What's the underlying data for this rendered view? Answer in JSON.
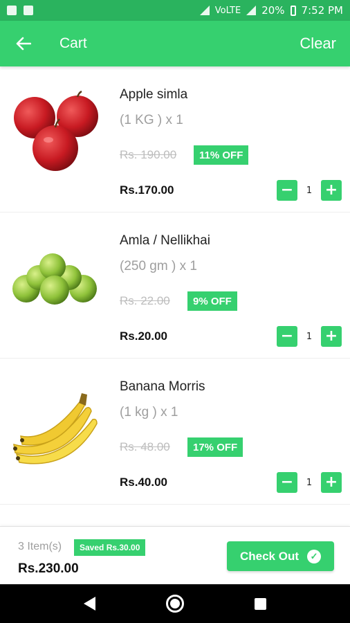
{
  "status_bar": {
    "signal_label": "VoLTE",
    "battery": "20%",
    "time": "7:52 PM"
  },
  "app_bar": {
    "title": "Cart",
    "clear_label": "Clear"
  },
  "items": [
    {
      "name": "Apple simla",
      "qty": "(1 KG ) x 1",
      "mrp": "Rs. 190.00",
      "discount": "11% OFF",
      "price": "Rs.170.00",
      "count": "1",
      "image": "apples"
    },
    {
      "name": "Amla / Nellikhai",
      "qty": "(250 gm ) x 1",
      "mrp": "Rs. 22.00",
      "discount": "9% OFF",
      "price": "Rs.20.00",
      "count": "1",
      "image": "amla"
    },
    {
      "name": "Banana Morris",
      "qty": "(1 kg ) x 1",
      "mrp": "Rs. 48.00",
      "discount": "17% OFF",
      "price": "Rs.40.00",
      "count": "1",
      "image": "bananas"
    }
  ],
  "footer": {
    "count": "3 Item(s)",
    "saved": "Saved Rs.30.00",
    "total": "Rs.230.00",
    "checkout_label": "Check Out"
  },
  "colors": {
    "primary": "#36d06f",
    "status": "#2ab35e"
  },
  "icons": {
    "back": "arrow-left-icon",
    "check": "check-circle-icon",
    "minus": "minus-icon",
    "plus": "plus-icon"
  }
}
